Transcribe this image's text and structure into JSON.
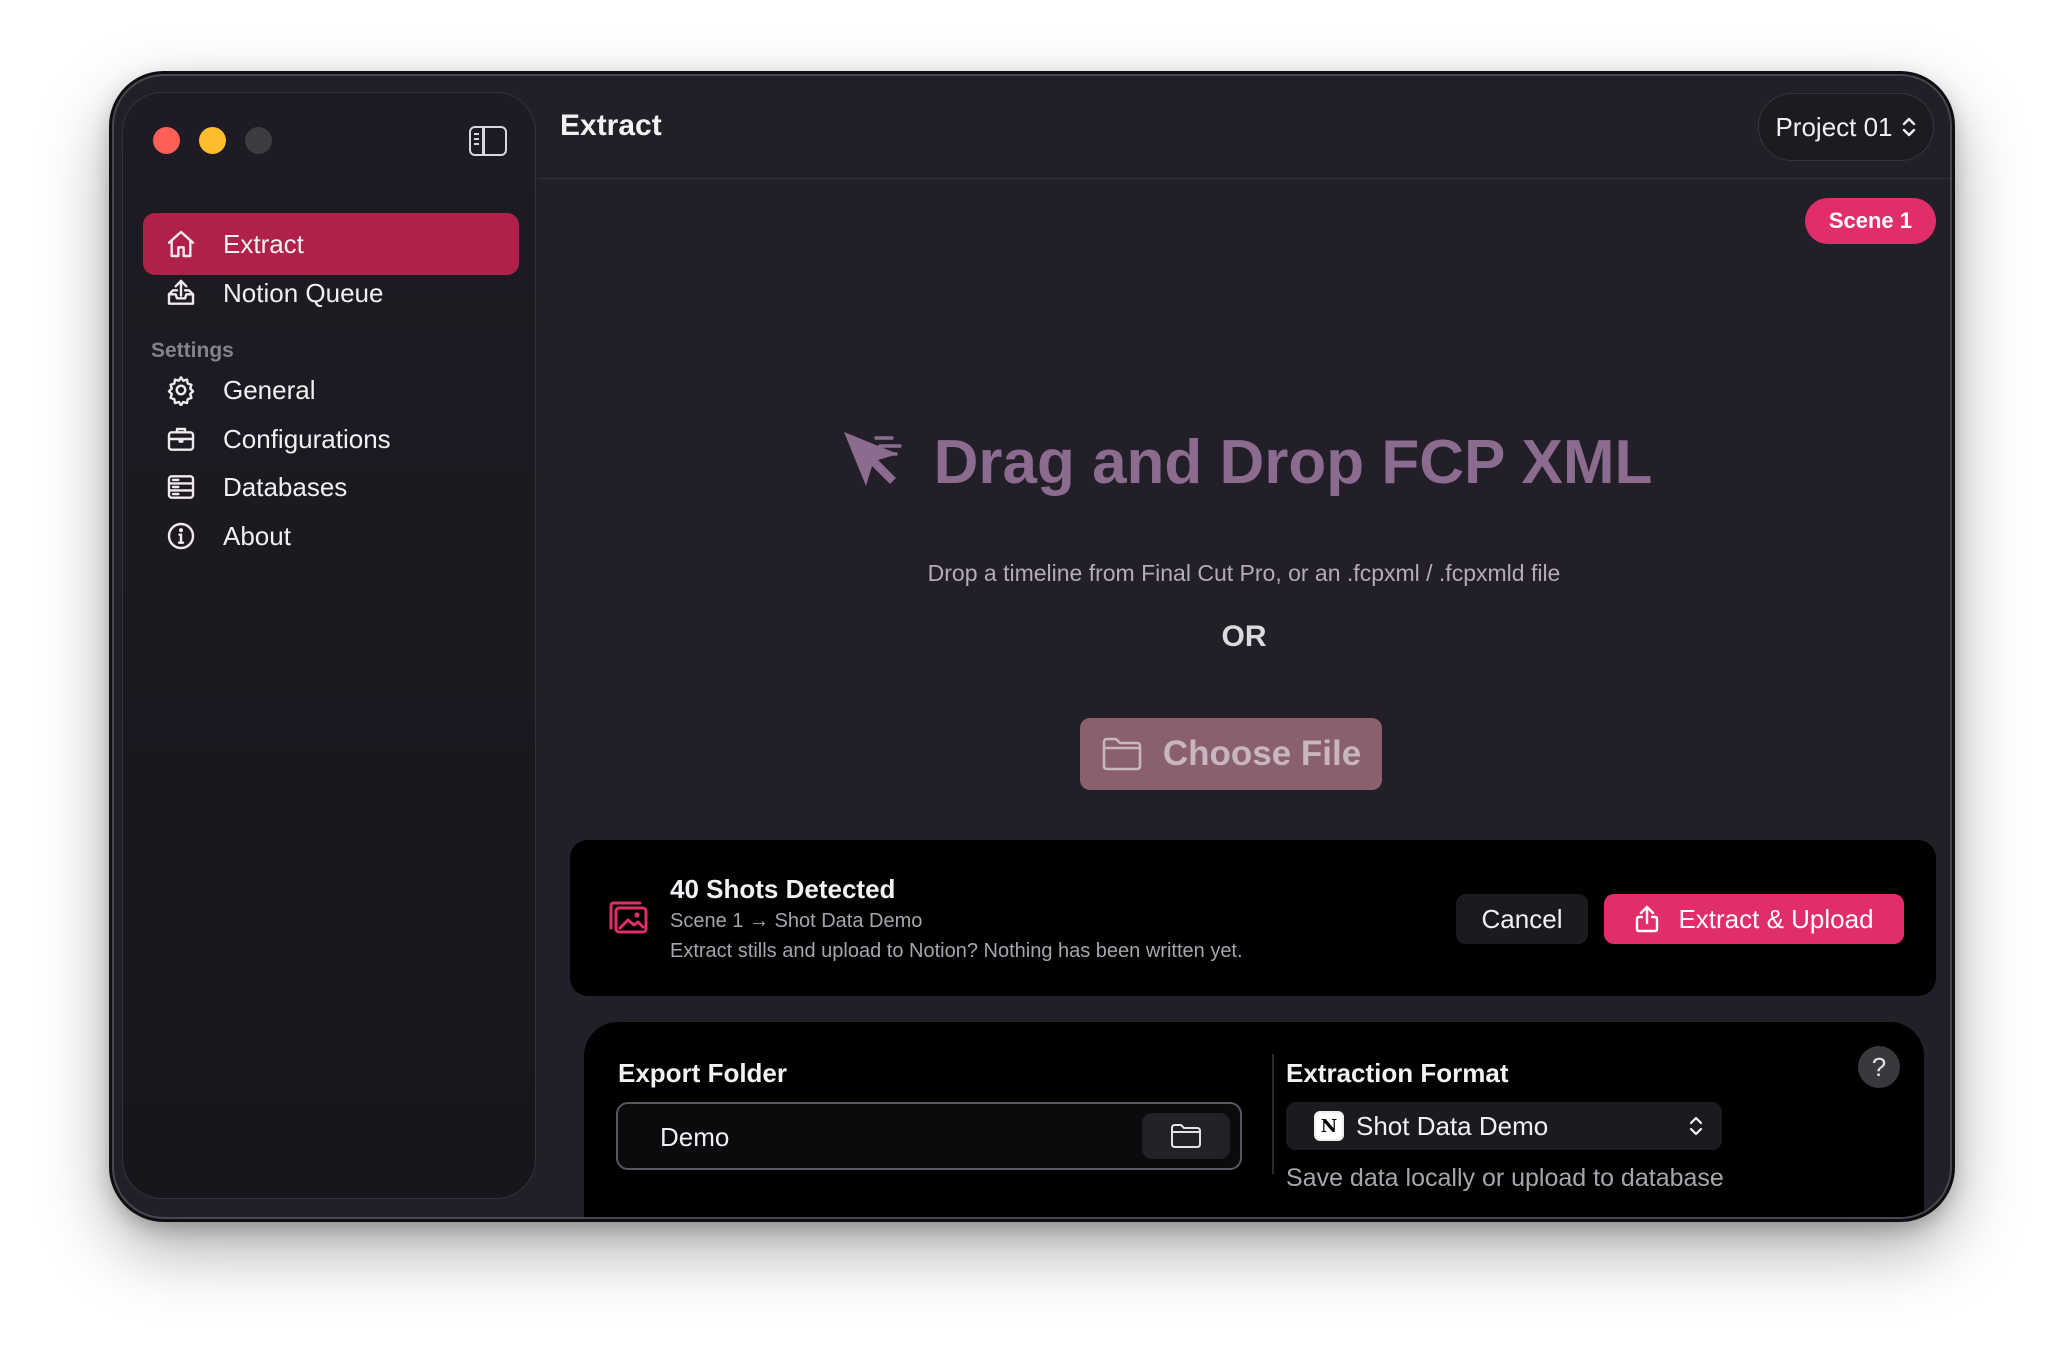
{
  "window": {
    "traffic_lights": [
      "close",
      "minimize",
      "zoom"
    ]
  },
  "sidebar": {
    "items": [
      {
        "label": "Extract",
        "icon": "house-icon",
        "active": true
      },
      {
        "label": "Notion Queue",
        "icon": "tray-upload-icon",
        "active": false
      }
    ],
    "section_label": "Settings",
    "settings_items": [
      {
        "label": "General",
        "icon": "gear-icon"
      },
      {
        "label": "Configurations",
        "icon": "briefcase-icon"
      },
      {
        "label": "Databases",
        "icon": "server-icon"
      },
      {
        "label": "About",
        "icon": "info-icon"
      }
    ]
  },
  "header": {
    "title": "Extract",
    "project": "Project 01"
  },
  "scene_badge": "Scene 1",
  "drop_zone": {
    "title": "Drag and Drop FCP XML",
    "subtitle": "Drop a timeline from Final Cut Pro, or an .fcpxml / .fcpxmld file",
    "or_label": "OR",
    "choose_label": "Choose File"
  },
  "shots": {
    "title": "40 Shots Detected",
    "route": "Scene 1 → Shot Data Demo",
    "message": "Extract stills and upload to Notion? Nothing has been written yet.",
    "cancel_label": "Cancel",
    "extract_label": "Extract & Upload"
  },
  "settings": {
    "export_label": "Export Folder",
    "export_value": "Demo",
    "format_label": "Extraction Format",
    "format_value": "Shot Data Demo",
    "format_help": "Save data locally or upload to database",
    "help_label": "?"
  },
  "colors": {
    "accent": "#e02e6a",
    "active_nav": "#b02149",
    "window_bg": "#221f29",
    "panel_bg": "#000000"
  }
}
